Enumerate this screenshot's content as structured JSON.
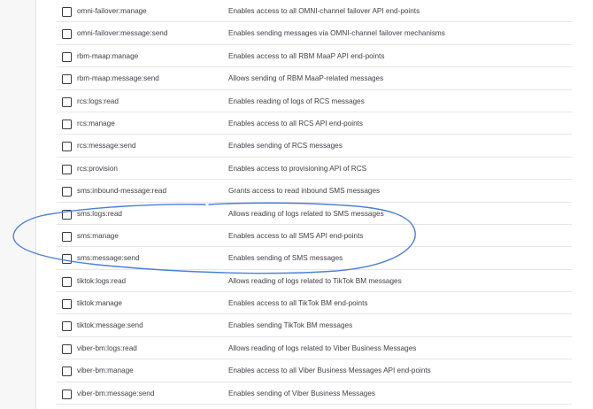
{
  "annotation_color": "#4a7fd4",
  "scopes": [
    {
      "name": "omni-failover:manage",
      "description": "Enables access to all OMNI-channel failover API end-points"
    },
    {
      "name": "omni-failover:message:send",
      "description": "Enables sending messages via OMNI-channel failover mechanisms"
    },
    {
      "name": "rbm-maap:manage",
      "description": "Enables access to all RBM MaaP API end-points"
    },
    {
      "name": "rbm-maap:message:send",
      "description": "Allows sending of RBM MaaP-related messages"
    },
    {
      "name": "rcs:logs:read",
      "description": "Enables reading of logs of RCS messages"
    },
    {
      "name": "rcs:manage",
      "description": "Enables access to all RCS API end-points"
    },
    {
      "name": "rcs:message:send",
      "description": "Enables sending of RCS messages"
    },
    {
      "name": "rcs:provision",
      "description": "Enables access to provisioning API of RCS"
    },
    {
      "name": "sms:inbound-message:read",
      "description": "Grants access to read inbound SMS messages"
    },
    {
      "name": "sms:logs:read",
      "description": "Allows reading of logs related to SMS messages"
    },
    {
      "name": "sms:manage",
      "description": "Enables access to all SMS API end-points"
    },
    {
      "name": "sms:message:send",
      "description": "Enables sending of SMS messages"
    },
    {
      "name": "tiktok:logs:read",
      "description": "Allows reading of logs related to TikTok BM messages"
    },
    {
      "name": "tiktok:manage",
      "description": "Enables access to all TikTok BM end-points"
    },
    {
      "name": "tiktok:message:send",
      "description": "Enables sending TikTok BM messages"
    },
    {
      "name": "viber-bm:logs:read",
      "description": "Allows reading of logs related to Viber Business Messages"
    },
    {
      "name": "viber-bm:manage",
      "description": "Enables access to all Viber Business Messages API end-points"
    },
    {
      "name": "viber-bm:message:send",
      "description": "Enables sending of Viber Business Messages"
    }
  ]
}
